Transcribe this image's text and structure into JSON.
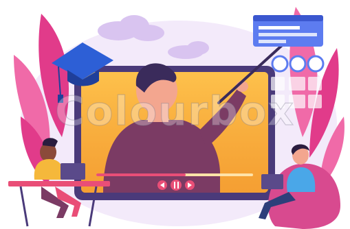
{
  "image": {
    "subject": "online-teaching-illustration",
    "palette": {
      "background": "#ffffff",
      "leaf_pink": "#e13b8a",
      "leaf_light": "#f06aa8",
      "blob_lavender": "#e9dcf6",
      "cloud": "#d9c4f0",
      "tablet_frame": "#4a3a7a",
      "screen_orange": "#f7a63a",
      "screen_yellow": "#ffc850",
      "teacher_shirt": "#7b3b64",
      "skin": "#f3a68f",
      "hair": "#3a2b5b",
      "cap_blue": "#2d5fd6",
      "widget_blue": "#5d7cf0",
      "desk_pink": "#e94e77",
      "student_shirt_yellow": "#f5b83b",
      "student_shirt_blue": "#4aa7e8",
      "chair_pink": "#d84a8f",
      "laptop": "#5a4a8a"
    },
    "watermark": "Colourbox"
  }
}
